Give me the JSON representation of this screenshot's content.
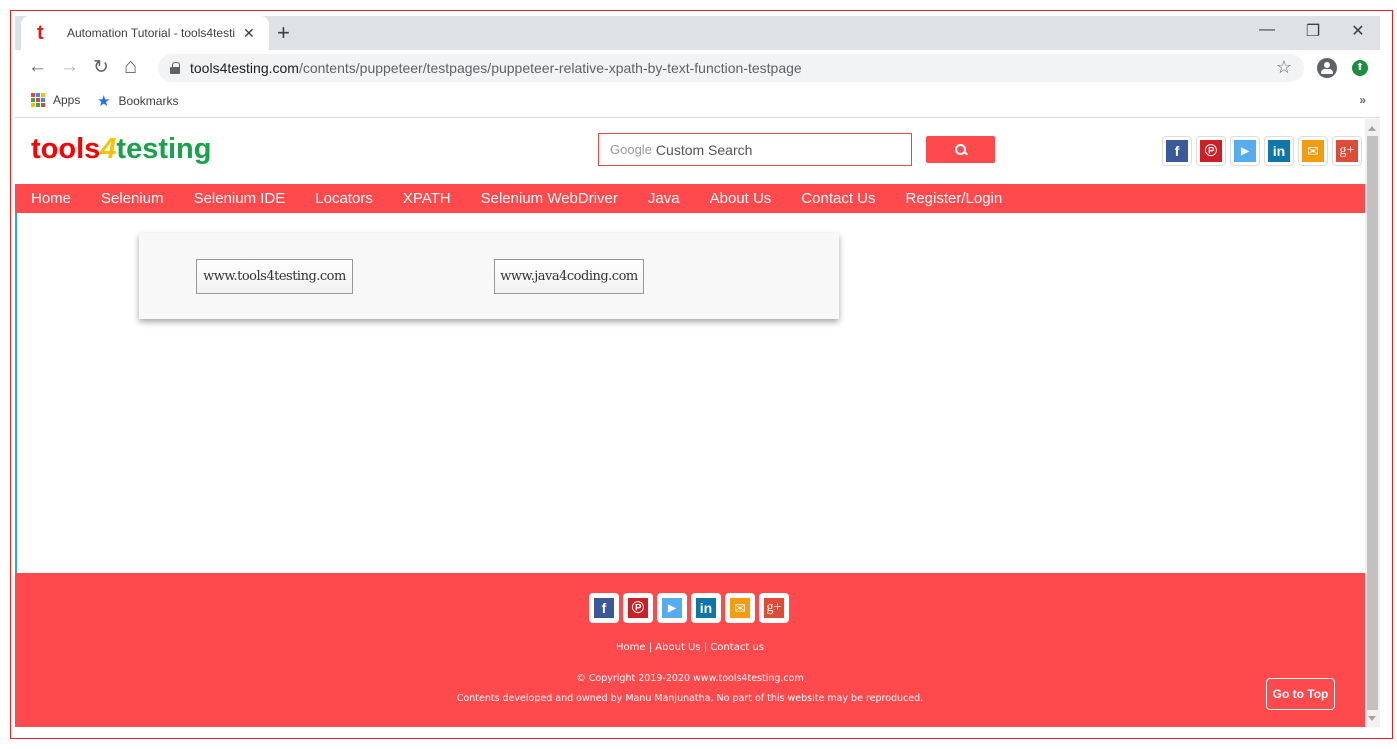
{
  "browser": {
    "tab": {
      "favicon": "t",
      "title": "Automation Tutorial - tools4testi",
      "close": "✕"
    },
    "new_tab": "+",
    "window_controls": {
      "minimize": "—",
      "restore": "❐",
      "close": "✕"
    },
    "nav": {
      "back": "←",
      "forward": "→",
      "reload": "↻",
      "home": "⌂"
    },
    "url": {
      "host": "tools4testing.com",
      "path": "/contents/puppeteer/testpages/puppeteer-relative-xpath-by-text-function-testpage"
    },
    "star": "☆",
    "update": "⬆",
    "bookmarks": {
      "apps": "Apps",
      "bookmarks": "Bookmarks",
      "overflow": "»"
    }
  },
  "site": {
    "logo": {
      "part1": "tools",
      "part2": "4",
      "part3": "testing"
    },
    "search": {
      "google": "Google",
      "placeholder": "Custom Search"
    },
    "social": [
      {
        "name": "facebook",
        "glyph": "f",
        "color": "#3b5998"
      },
      {
        "name": "pinterest",
        "glyph": "℗",
        "color": "#cb2027"
      },
      {
        "name": "twitter",
        "glyph": "🐦",
        "color": "#55acee"
      },
      {
        "name": "linkedin",
        "glyph": "in",
        "color": "#0e76a8"
      },
      {
        "name": "email",
        "glyph": "✉",
        "color": "#f39c12"
      },
      {
        "name": "google-plus",
        "glyph": "g+",
        "color": "#dd4b39"
      }
    ],
    "nav": [
      "Home",
      "Selenium",
      "Selenium IDE",
      "Locators",
      "XPATH",
      "Selenium WebDriver",
      "Java",
      "About Us",
      "Contact Us",
      "Register/Login"
    ],
    "buttons": {
      "tools4testing": "www.tools4testing.com",
      "java4coding": "www.java4coding.com"
    },
    "footer": {
      "links": [
        "Home",
        "About Us",
        "Contact us"
      ],
      "copyright": "© Copyright 2019-2020 www.tools4testing.com",
      "owned": "Contents developed and owned by Manu Manjunatha, No part of this website may be reproduced.",
      "go_top": "Go to Top"
    }
  },
  "colors": {
    "brand_red": "#ff4a4d",
    "frame": "#d9262b"
  }
}
